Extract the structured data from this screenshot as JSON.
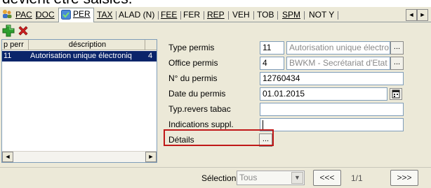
{
  "header_cut_text": "devient être saisies.",
  "tabs": [
    {
      "label": "PAC",
      "underline": "A"
    },
    {
      "label": "DOC"
    },
    {
      "label": "PER",
      "active": true
    },
    {
      "label": "TAX"
    },
    {
      "label": "ALAD (N)"
    },
    {
      "label": "FEE"
    },
    {
      "label": "FER"
    },
    {
      "label": "REP"
    },
    {
      "label": "VEH"
    },
    {
      "label": "TOB"
    },
    {
      "label": "SPM"
    },
    {
      "label": "NOT Y"
    }
  ],
  "tab_nav": {
    "left": "◄",
    "right": "►"
  },
  "list": {
    "columns": [
      "p perr",
      "déscription",
      ""
    ],
    "rows": [
      {
        "code": "11",
        "description": "Autorisation unique électroniq",
        "num": "4"
      }
    ],
    "scroll_left": "◄",
    "scroll_right": "►"
  },
  "form": {
    "type_label": "Type permis",
    "type_code": "11",
    "type_text": "Autorisation unique électroni",
    "office_label": "Office permis",
    "office_code": "4",
    "office_text": "BWKM - Secrétariat d'Etat à",
    "number_label": "N° du permis",
    "number_value": "12760434",
    "date_label": "Date du permis",
    "date_value": "01.01.2015",
    "tobacco_label": "Typ.revers tabac",
    "tobacco_value": "",
    "indications_label": "Indications suppl.",
    "indications_value": "",
    "details_label": "Détails",
    "ellipsis": "..."
  },
  "bottom": {
    "selection_label": "Sélection",
    "selection_value": "Tous",
    "dropdown_arrow": "▼",
    "prev": "<<<",
    "page": "1/1",
    "next": ">>>"
  },
  "colors": {
    "window_bg": "#ece9d8",
    "selection_bg": "#0a246a",
    "highlight_border": "#c01818",
    "add_icon": "#2e9e2e",
    "delete_icon": "#d02020"
  }
}
